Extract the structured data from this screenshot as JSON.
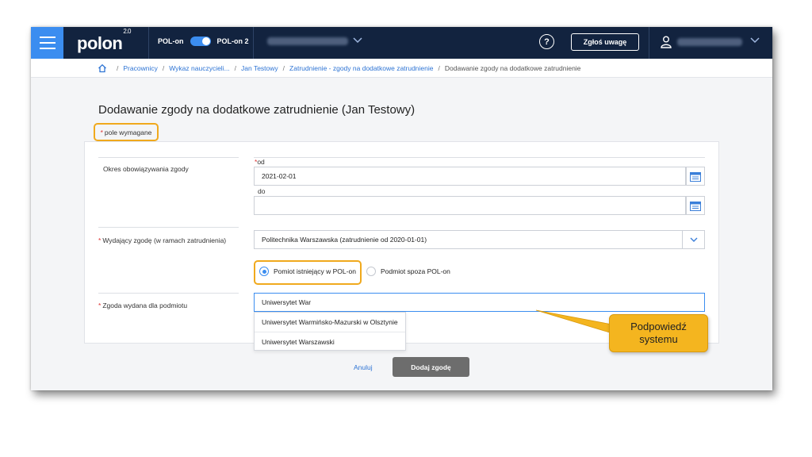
{
  "header": {
    "logo": "polon",
    "logo_version": "2.0",
    "toggle_left": "POL-on",
    "toggle_right": "POL-on 2",
    "help": "?",
    "report_button": "Zgłoś uwagę",
    "icons": [
      "menu-icon",
      "chevron-down-icon",
      "help-icon",
      "user-icon"
    ]
  },
  "breadcrumb": {
    "items": [
      "Pracownicy",
      "Wykaz nauczycieli...",
      "Jan Testowy",
      "Zatrudnienie - zgody na dodatkowe zatrudnienie"
    ],
    "current": "Dodawanie zgody na dodatkowe zatrudnienie",
    "separator": "/"
  },
  "page": {
    "title": "Dodawanie zgody na dodatkowe zatrudnienie (Jan Testowy)",
    "required_note": "pole wymagane",
    "required_marker": "*"
  },
  "form": {
    "period_label": "Okres obowiązywania zgody",
    "from_label": "od",
    "from_value": "2021-02-01",
    "to_label": "do",
    "to_value": "",
    "issuer_label": "Wydający zgodę (w ramach zatrudnienia)",
    "issuer_value": "Politechnika Warszawska (zatrudnienie od 2020-01-01)",
    "radio_existing": "Pomiot istniejący w POL-on",
    "radio_external": "Podmiot spoza POL-on",
    "radio_selected": "existing",
    "entity_label": "Zgoda wydana dla podmiotu",
    "entity_value": "Uniwersytet War",
    "suggestions": [
      "Uniwersytet Warmińsko-Mazurski w Olsztynie",
      "Uniwersytet Warszawski"
    ]
  },
  "actions": {
    "cancel": "Anuluj",
    "submit": "Dodaj zgodę"
  },
  "callout": {
    "line1": "Podpowiedź",
    "line2": "systemu"
  },
  "colors": {
    "topbar": "#12233f",
    "accent": "#3b8df0",
    "highlight": "#f0a91d",
    "callout": "#f4b51f",
    "submit": "#6d6d6d"
  }
}
